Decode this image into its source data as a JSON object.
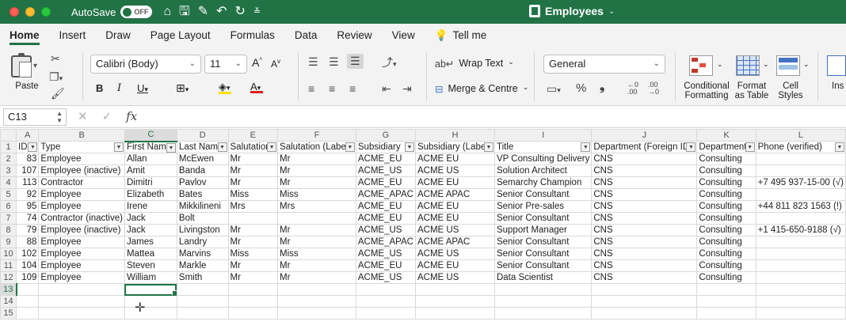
{
  "window": {
    "title": "Employees",
    "autosave_label": "AutoSave",
    "autosave_state": "OFF"
  },
  "tabs": [
    "Home",
    "Insert",
    "Draw",
    "Page Layout",
    "Formulas",
    "Data",
    "Review",
    "View"
  ],
  "tell_me": "Tell me",
  "ribbon": {
    "paste_label": "Paste",
    "font_name": "Calibri (Body)",
    "font_size": "11",
    "wrap_text": "Wrap Text",
    "merge_centre": "Merge & Centre",
    "number_format": "General",
    "conditional_formatting": [
      "Conditional",
      "Formatting"
    ],
    "format_as_table": [
      "Format",
      "as Table"
    ],
    "cell_styles": [
      "Cell",
      "Styles"
    ],
    "insert_partial": "Ins",
    "colors": {
      "accent": "#217346",
      "highlight": "#ffe100",
      "font_color": "#e02020"
    }
  },
  "formula_bar": {
    "name_box": "C13",
    "formula": ""
  },
  "grid": {
    "columns": [
      "A",
      "B",
      "C",
      "D",
      "E",
      "F",
      "G",
      "H",
      "I",
      "J",
      "K",
      "L"
    ],
    "headers": [
      "ID",
      "Type",
      "First Name",
      "Last Name",
      "Salutation",
      "Salutation (Label)",
      "Subsidiary",
      "Subsidiary (Label)",
      "Title",
      "Department  (Foreign ID)",
      "Department",
      "Phone (verified)"
    ],
    "rows": [
      [
        "83",
        "Employee",
        "Allan",
        "McEwen",
        "Mr",
        "Mr",
        "ACME_EU",
        "ACME EU",
        "VP Consulting Delivery",
        "CNS",
        "Consulting",
        ""
      ],
      [
        "107",
        "Employee (inactive)",
        "Amit",
        "Banda",
        "Mr",
        "Mr",
        "ACME_US",
        "ACME US",
        "Solution Architect",
        "CNS",
        "Consulting",
        ""
      ],
      [
        "113",
        "Contractor",
        "Dimitri",
        "Pavlov",
        "Mr",
        "Mr",
        "ACME_EU",
        "ACME EU",
        "Semarchy Champion",
        "CNS",
        "Consulting",
        "+7 495 937-15-00 (√)"
      ],
      [
        "92",
        "Employee",
        "Elizabeth",
        "Bates",
        "Miss",
        "Miss",
        "ACME_APAC",
        "ACME APAC",
        "Senior Consultant",
        "CNS",
        "Consulting",
        ""
      ],
      [
        "95",
        "Employee",
        "Irene",
        "Mikkilineni",
        "Mrs",
        "Mrs",
        "ACME_EU",
        "ACME EU",
        "Senior Pre-sales",
        "CNS",
        "Consulting",
        "+44 811 823 1563 (!)"
      ],
      [
        "74",
        "Contractor (inactive)",
        "Jack",
        "Bolt",
        "",
        "",
        "ACME_EU",
        "ACME EU",
        "Senior Consultant",
        "CNS",
        "Consulting",
        ""
      ],
      [
        "79",
        "Employee (inactive)",
        "Jack",
        "Livingston",
        "Mr",
        "Mr",
        "ACME_US",
        "ACME US",
        "Support Manager",
        "CNS",
        "Consulting",
        "+1 415-650-9188 (√)"
      ],
      [
        "88",
        "Employee",
        "James",
        "Landry",
        "Mr",
        "Mr",
        "ACME_APAC",
        "ACME APAC",
        "Senior Consultant",
        "CNS",
        "Consulting",
        ""
      ],
      [
        "102",
        "Employee",
        "Mattea",
        "Marvins",
        "Miss",
        "Miss",
        "ACME_US",
        "ACME US",
        "Senior Consultant",
        "CNS",
        "Consulting",
        ""
      ],
      [
        "104",
        "Employee",
        "Steven",
        "Markle",
        "Mr",
        "Mr",
        "ACME_EU",
        "ACME EU",
        "Senior Consultant",
        "CNS",
        "Consulting",
        ""
      ],
      [
        "109",
        "Employee",
        "William",
        "Smith",
        "Mr",
        "Mr",
        "ACME_US",
        "ACME US",
        "Data Scientist",
        "CNS",
        "Consulting",
        ""
      ]
    ],
    "row_numbers": [
      "1",
      "2",
      "3",
      "4",
      "5",
      "6",
      "7",
      "8",
      "9",
      "10",
      "11",
      "12",
      "13",
      "14",
      "15"
    ],
    "selected_cell": "C13"
  }
}
